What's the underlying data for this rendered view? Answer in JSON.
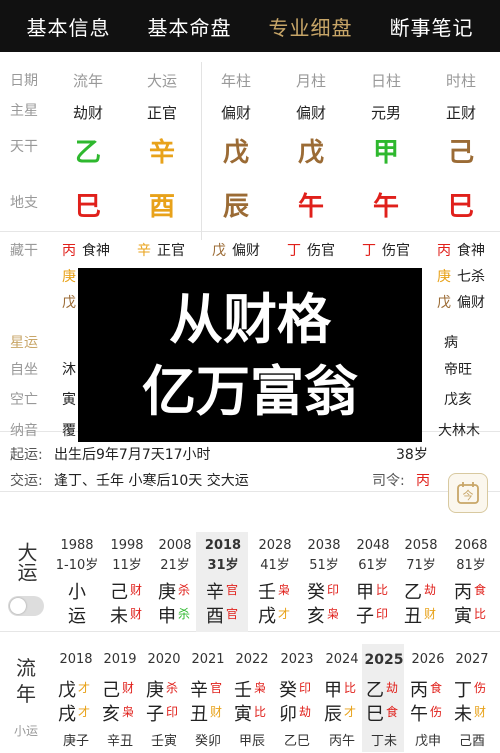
{
  "nav": {
    "tabs": [
      "基本信息",
      "基本命盘",
      "专业细盘",
      "断事笔记"
    ],
    "active": 2
  },
  "chart": {
    "row_labels": {
      "date": "日期",
      "main_star": "主星",
      "heaven": "天干",
      "earth": "地支"
    },
    "columns": [
      {
        "header": "流年",
        "ten_god": "劫财",
        "gan": "乙",
        "gan_color": "#2eb82e",
        "zhi": "巳",
        "zhi_color": "#e0201b"
      },
      {
        "header": "大运",
        "ten_god": "正官",
        "gan": "辛",
        "gan_color": "#e8a21a",
        "zhi": "酉",
        "zhi_color": "#e8a21a"
      },
      {
        "header": "年柱",
        "ten_god": "偏财",
        "gan": "戊",
        "gan_color": "#9b6b35",
        "zhi": "辰",
        "zhi_color": "#9b6b35"
      },
      {
        "header": "月柱",
        "ten_god": "偏财",
        "gan": "戊",
        "gan_color": "#9b6b35",
        "zhi": "午",
        "zhi_color": "#e0201b"
      },
      {
        "header": "日柱",
        "ten_god": "元男",
        "gan": "甲",
        "gan_color": "#2eb82e",
        "zhi": "午",
        "zhi_color": "#e0201b"
      },
      {
        "header": "时柱",
        "ten_god": "正财",
        "gan": "己",
        "gan_color": "#9b6b35",
        "zhi": "巳",
        "zhi_color": "#e0201b"
      }
    ]
  },
  "hidden": {
    "row_labels": [
      "藏干",
      "星运",
      "自坐",
      "空亡",
      "纳音"
    ],
    "row1": [
      {
        "g": "丙",
        "gc": "#e0201b",
        "t": "食神"
      },
      {
        "g": "辛",
        "gc": "#e8a21a",
        "t": "正官"
      },
      {
        "g": "戊",
        "gc": "#9b6b35",
        "t": "偏财"
      },
      {
        "g": "丁",
        "gc": "#e0201b",
        "t": "伤官"
      },
      {
        "g": "丁",
        "gc": "#e0201b",
        "t": "伤官"
      },
      {
        "g": "丙",
        "gc": "#e0201b",
        "t": "食神"
      }
    ],
    "row2_left": {
      "g": "庚",
      "gc": "#e8a21a"
    },
    "row3_left": {
      "g": "戊",
      "gc": "#9b6b35"
    },
    "row2_right": {
      "g": "庚",
      "gc": "#e8a21a",
      "t": "七杀"
    },
    "row3_right": {
      "g": "戊",
      "gc": "#9b6b35",
      "t": "偏财"
    },
    "left_peek": [
      "沐",
      "寅",
      "覆"
    ],
    "right_col": [
      "病",
      "帝旺",
      "戊亥",
      "大林木"
    ]
  },
  "overlay": {
    "line1": "从财格",
    "line2": "亿万富翁"
  },
  "info": {
    "qiyun_label": "起运:",
    "qiyun_text": "出生后9年7月7天17小时",
    "age": "38岁",
    "jiaoyun_label": "交运:",
    "jiaoyun_text": "逢丁、壬年 小寒后10天 交大运",
    "siling_label": "司令:",
    "siling_value": "丙",
    "cal_icon_text": "今"
  },
  "dayun": {
    "label": "大运",
    "items": [
      {
        "year": "1988",
        "age": "1-10岁",
        "gz1": "小",
        "gz2": "运",
        "s1": "",
        "s2": "",
        "c1": "#222",
        "c2": "#222"
      },
      {
        "year": "1998",
        "age": "11岁",
        "gz1": "己",
        "gz2": "未",
        "s1": "财",
        "s2": "财",
        "c1": "#e0201b",
        "c2": "#e0201b"
      },
      {
        "year": "2008",
        "age": "21岁",
        "gz1": "庚",
        "gz2": "申",
        "s1": "杀",
        "s2": "杀",
        "c1": "#e0201b",
        "c2": "#2eb82e"
      },
      {
        "year": "2018",
        "age": "31岁",
        "gz1": "辛",
        "gz2": "酉",
        "s1": "官",
        "s2": "官",
        "c1": "#e0201b",
        "c2": "#e0201b"
      },
      {
        "year": "2028",
        "age": "41岁",
        "gz1": "壬",
        "gz2": "戌",
        "s1": "枭",
        "s2": "才",
        "c1": "#e0201b",
        "c2": "#e8a21a"
      },
      {
        "year": "2038",
        "age": "51岁",
        "gz1": "癸",
        "gz2": "亥",
        "s1": "印",
        "s2": "枭",
        "c1": "#e0201b",
        "c2": "#e0201b"
      },
      {
        "year": "2048",
        "age": "61岁",
        "gz1": "甲",
        "gz2": "子",
        "s1": "比",
        "s2": "印",
        "c1": "#e0201b",
        "c2": "#e0201b"
      },
      {
        "year": "2058",
        "age": "71岁",
        "gz1": "乙",
        "gz2": "丑",
        "s1": "劫",
        "s2": "财",
        "c1": "#e0201b",
        "c2": "#e8a21a"
      },
      {
        "year": "2068",
        "age": "81岁",
        "gz1": "丙",
        "gz2": "寅",
        "s1": "食",
        "s2": "比",
        "c1": "#e0201b",
        "c2": "#e0201b"
      }
    ]
  },
  "liunian": {
    "label1": "流",
    "label2": "年",
    "small_label": "小运",
    "items": [
      {
        "year": "2018",
        "gz1": "戊",
        "gz2": "戌",
        "s1": "才",
        "s2": "才",
        "c1": "#e8a21a",
        "c2": "#e8a21a",
        "sy": "庚子"
      },
      {
        "year": "2019",
        "gz1": "己",
        "gz2": "亥",
        "s1": "财",
        "s2": "枭",
        "c1": "#e0201b",
        "c2": "#e0201b",
        "sy": "辛丑"
      },
      {
        "year": "2020",
        "gz1": "庚",
        "gz2": "子",
        "s1": "杀",
        "s2": "印",
        "c1": "#e0201b",
        "c2": "#e0201b",
        "sy": "壬寅"
      },
      {
        "year": "2021",
        "gz1": "辛",
        "gz2": "丑",
        "s1": "官",
        "s2": "财",
        "c1": "#e0201b",
        "c2": "#e8a21a",
        "sy": "癸卯"
      },
      {
        "year": "2022",
        "gz1": "壬",
        "gz2": "寅",
        "s1": "枭",
        "s2": "比",
        "c1": "#e0201b",
        "c2": "#e0201b",
        "sy": "甲辰"
      },
      {
        "year": "2023",
        "gz1": "癸",
        "gz2": "卯",
        "s1": "印",
        "s2": "劫",
        "c1": "#e0201b",
        "c2": "#e0201b",
        "sy": "乙巳"
      },
      {
        "year": "2024",
        "gz1": "甲",
        "gz2": "辰",
        "s1": "比",
        "s2": "才",
        "c1": "#e0201b",
        "c2": "#e8a21a",
        "sy": "丙午"
      },
      {
        "year": "2025",
        "gz1": "乙",
        "gz2": "巳",
        "s1": "劫",
        "s2": "食",
        "c1": "#e0201b",
        "c2": "#e0201b",
        "sy": "丁未"
      },
      {
        "year": "2026",
        "gz1": "丙",
        "gz2": "午",
        "s1": "食",
        "s2": "伤",
        "c1": "#e0201b",
        "c2": "#e0201b",
        "sy": "戊申"
      },
      {
        "year": "2027",
        "gz1": "丁",
        "gz2": "未",
        "s1": "伤",
        "s2": "财",
        "c1": "#e0201b",
        "c2": "#e8a21a",
        "sy": "己酉"
      }
    ]
  }
}
